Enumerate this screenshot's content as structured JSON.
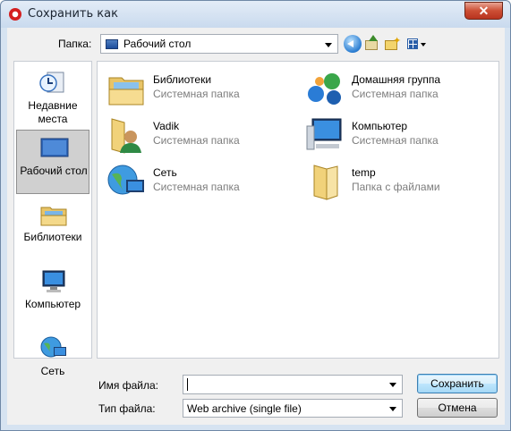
{
  "window": {
    "title": "Сохранить как",
    "close_glyph": "✕"
  },
  "toolbar": {
    "folder_label": "Папка:",
    "folder_value": "Рабочий стол"
  },
  "places": [
    {
      "label": "Недавние места",
      "icon": "recent-places-icon"
    },
    {
      "label": "Рабочий стол",
      "icon": "desktop-icon",
      "selected": true
    },
    {
      "label": "Библиотеки",
      "icon": "libraries-icon"
    },
    {
      "label": "Компьютер",
      "icon": "computer-icon"
    },
    {
      "label": "Сеть",
      "icon": "network-icon"
    }
  ],
  "items": [
    {
      "name": "Библиотеки",
      "sub": "Системная папка",
      "icon": "libraries-icon"
    },
    {
      "name": "Домашняя группа",
      "sub": "Системная папка",
      "icon": "homegroup-icon"
    },
    {
      "name": "Vadik",
      "sub": "Системная папка",
      "icon": "user-folder-icon"
    },
    {
      "name": "Компьютер",
      "sub": "Системная папка",
      "icon": "computer-icon"
    },
    {
      "name": "Сеть",
      "sub": "Системная папка",
      "icon": "network-icon"
    },
    {
      "name": "temp",
      "sub": "Папка с файлами",
      "icon": "folder-icon"
    }
  ],
  "form": {
    "filename_label": "Имя файла:",
    "filename_value": "",
    "filetype_label": "Тип файла:",
    "filetype_value": "Web archive (single file)"
  },
  "buttons": {
    "save": "Сохранить",
    "cancel": "Отмена"
  }
}
